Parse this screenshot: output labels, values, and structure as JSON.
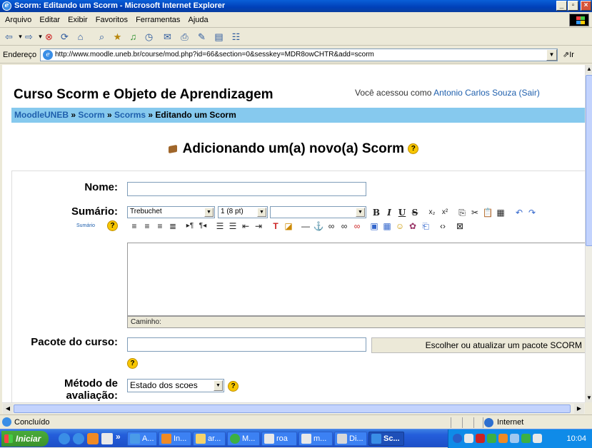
{
  "window": {
    "title": "Scorm: Editando um Scorm - Microsoft Internet Explorer",
    "controls": [
      "_",
      "▫",
      "×"
    ]
  },
  "menu": [
    "Arquivo",
    "Editar",
    "Exibir",
    "Favoritos",
    "Ferramentas",
    "Ajuda"
  ],
  "address": {
    "label": "Endereço",
    "url": "http://www.moodle.uneb.br/course/mod.php?id=66&section=0&sesskey=MDR8owCHTR&add=scorm",
    "go": "Ir"
  },
  "page": {
    "course_title": "Curso Scorm e Objeto de Aprendizagem",
    "login_prefix": "Você acessou como ",
    "login_user": "Antonio Carlos Souza",
    "logout": "(Sair)",
    "breadcrumb": {
      "home": "MoodleUNEB",
      "sep": " » ",
      "course": "Scorm",
      "module": "Scorms",
      "current": "Editando um Scorm"
    },
    "heading": "Adicionando um(a) novo(a) Scorm"
  },
  "form": {
    "name_label": "Nome:",
    "name_value": "",
    "summary_label": "Sumário:",
    "summary_help": "Sumário",
    "font_family": "Trebuchet",
    "font_size": "1 (8 pt)",
    "font_style": "",
    "editor_path": "Caminho:",
    "package_label": "Pacote do curso:",
    "package_value": "",
    "package_button": "Escolher ou atualizar um pacote SCORM",
    "method_label_1": "Método de",
    "method_label_2": "avaliação:",
    "method_value": "Estado dos scoes"
  },
  "status": {
    "text": "Concluído",
    "zone": "Internet"
  },
  "taskbar": {
    "start": "Iniciar",
    "chevron": "»",
    "tasks": [
      "A...",
      "In...",
      "ar...",
      "M...",
      "roa",
      "m...",
      "Di...",
      "Sc..."
    ],
    "clock": "10:04"
  },
  "colors": {
    "navbar": "#86c9ee",
    "link": "#1e5fad",
    "titlebar": "#0a5fd8"
  }
}
